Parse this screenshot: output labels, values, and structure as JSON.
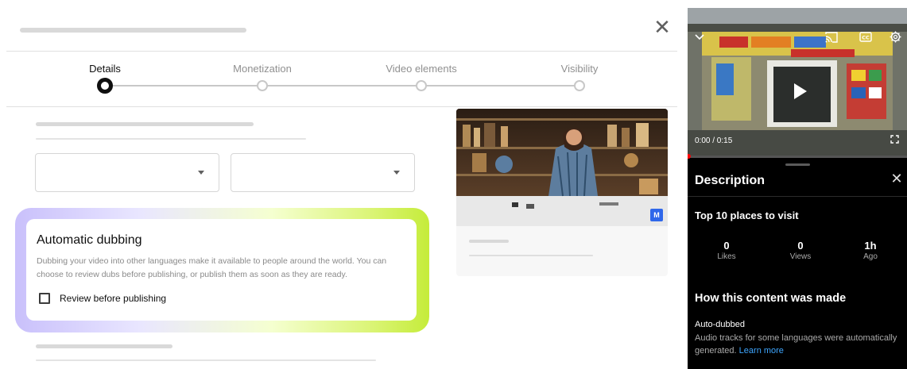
{
  "dialog": {
    "steps": [
      {
        "label": "Details",
        "active": true
      },
      {
        "label": "Monetization",
        "active": false
      },
      {
        "label": "Video elements",
        "active": false
      },
      {
        "label": "Visibility",
        "active": false
      }
    ],
    "automatic_dubbing": {
      "title": "Automatic dubbing",
      "description": "Dubbing your video into other languages make it available to people around the world. You can choose to review dubs before publishing, or publish them as soon as they are ready.",
      "checkbox_label": "Review before publishing",
      "checkbox_checked": false
    },
    "preview": {
      "badge": "M"
    },
    "icons": {
      "close": "close-icon",
      "select_caret": "caret-down-icon"
    }
  },
  "player": {
    "time": "0:00 / 0:15",
    "progress_fraction": 0,
    "icons": [
      "chevron-down-icon",
      "cast-icon",
      "cc-icon",
      "settings-icon",
      "play-icon",
      "fullscreen-icon"
    ]
  },
  "description": {
    "heading": "Description",
    "video_title": "Top 10 places to visit",
    "stats": [
      {
        "value": "0",
        "label": "Likes"
      },
      {
        "value": "0",
        "label": "Views"
      },
      {
        "value": "1h",
        "label": "Ago"
      }
    ],
    "how_made_heading": "How this content was made",
    "auto_dubbed_title": "Auto-dubbed",
    "auto_dubbed_text": "Audio tracks for some languages were automatically generated.",
    "learn_more": "Learn more"
  },
  "colors": {
    "link": "#3ea6ff",
    "progress": "#ff0000",
    "badge": "#2f67ea"
  }
}
